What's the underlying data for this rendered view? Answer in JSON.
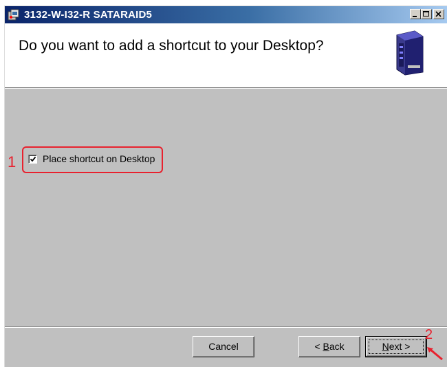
{
  "window": {
    "title": "3132-W-I32-R SATARAID5",
    "controls": [
      "minimize",
      "maximize",
      "close"
    ]
  },
  "header": {
    "heading": "Do you want to add a shortcut to your Desktop?"
  },
  "options": {
    "place_shortcut": {
      "label": "Place shortcut on Desktop",
      "checked": true
    }
  },
  "buttons": {
    "cancel": "Cancel",
    "back_prefix": "< ",
    "back_mnemonic": "B",
    "back_rest": "ack",
    "next_mnemonic": "N",
    "next_rest": "ext >"
  },
  "annotations": {
    "step1": "1",
    "step2": "2",
    "color": "#e8212e"
  },
  "colors": {
    "titlebar_start": "#0a246a",
    "titlebar_end": "#a6caf0",
    "body": "#c0c0c0"
  }
}
